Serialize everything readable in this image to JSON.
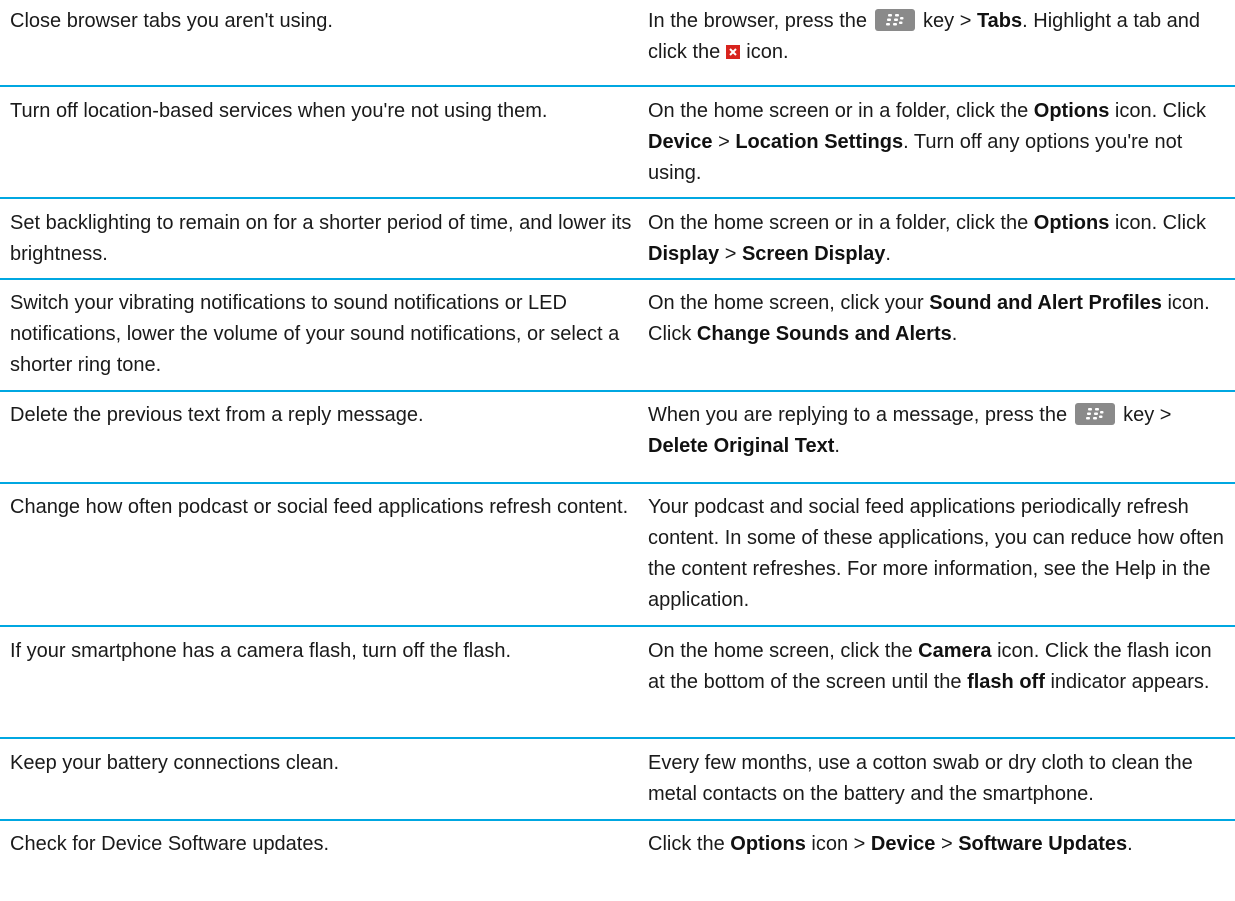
{
  "rows": [
    {
      "tip": "Close browser tabs you aren't using.",
      "how": {
        "p1": "In the browser, press the",
        "p2": "key >",
        "b1": "Tabs",
        "p3": ". Highlight a tab and click the",
        "p4": "icon."
      }
    },
    {
      "tip": "Turn off location-based services when you're not using them.",
      "how": {
        "p1": "On the home screen or in a folder, click the",
        "b1": "Options",
        "p2": "icon. Click",
        "b2": "Device",
        "p3": ">",
        "b3": "Location Settings",
        "p4": ". Turn off any options you're not using."
      }
    },
    {
      "tip": "Set backlighting to remain on for a shorter period of time, and lower its brightness.",
      "how": {
        "p1": "On the home screen or in a folder, click the",
        "b1": "Options",
        "p2": "icon. Click",
        "b2": "Display",
        "p3": ">",
        "b3": "Screen Display",
        "p4": "."
      }
    },
    {
      "tip": "Switch your vibrating notifications to sound notifications or LED notifications, lower the volume of your sound notifications, or select a shorter ring tone.",
      "how": {
        "p1": "On the home screen, click your",
        "b1": "Sound and Alert Profiles",
        "p2": "icon. Click",
        "b2": "Change Sounds and Alerts",
        "p3": "."
      }
    },
    {
      "tip": "Delete the previous text from a reply message.",
      "how": {
        "p1": "When you are replying to a message, press the",
        "p2": "key >",
        "b1": "Delete Original Text",
        "p3": "."
      }
    },
    {
      "tip": "Change how often podcast or social feed applications refresh content.",
      "how": {
        "p1": "Your podcast and social feed applications periodically refresh content. In some of these applications, you can reduce how often the content refreshes. For more information, see the Help in the application."
      }
    },
    {
      "tip": "If your smartphone has a camera flash, turn off the flash.",
      "how": {
        "p1": "On the home screen, click the",
        "b1": "Camera",
        "p2": "icon. Click the flash icon at the bottom of the screen until the",
        "b2": "flash off",
        "p3": "indicator appears."
      }
    },
    {
      "tip": "Keep your battery connections clean.",
      "how": {
        "p1": "Every few months, use a cotton swab or dry cloth to clean the metal contacts on the battery and the smartphone."
      }
    },
    {
      "tip": "Check for Device Software updates.",
      "how": {
        "p1": "Click the",
        "b1": "Options",
        "p2": "icon >",
        "b2": "Device",
        "p3": ">",
        "b3": "Software Updates",
        "p4": "."
      }
    }
  ],
  "colors": {
    "separator": "#00a7e1",
    "menu_key": "#8a8a8a",
    "close_icon": "#d8231d"
  },
  "icons": {
    "menu_key": "blackberry-menu-key-icon",
    "close": "close-tab-icon"
  }
}
